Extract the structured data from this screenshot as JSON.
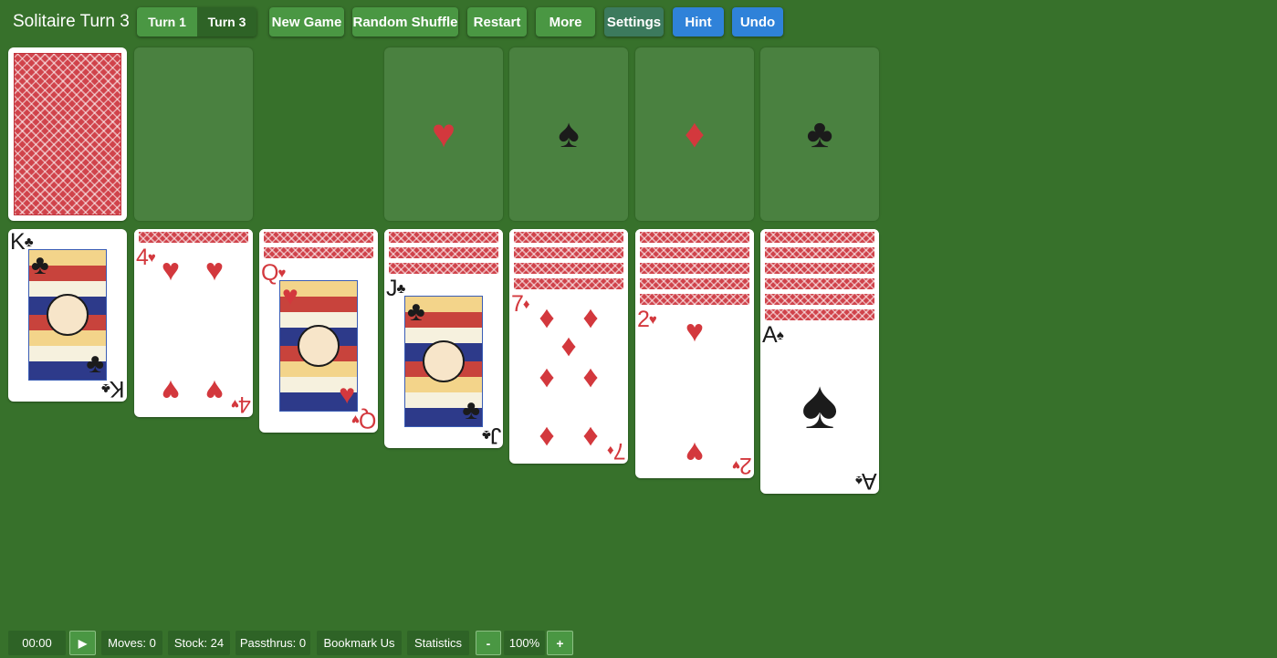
{
  "app": {
    "title": "Solitaire Turn 3"
  },
  "toolbar": {
    "turn1": "Turn 1",
    "turn3": "Turn 3",
    "new_game": "New Game",
    "random_shuffle": "Random Shuffle",
    "restart": "Restart",
    "more": "More",
    "settings": "Settings",
    "hint": "Hint",
    "undo": "Undo"
  },
  "foundations": [
    {
      "suit": "♥",
      "color": "red"
    },
    {
      "suit": "♠",
      "color": "black"
    },
    {
      "suit": "♦",
      "color": "red"
    },
    {
      "suit": "♣",
      "color": "black"
    }
  ],
  "tableau": [
    {
      "face_down": 0,
      "rank": "K",
      "suit": "♣",
      "color": "black"
    },
    {
      "face_down": 1,
      "rank": "4",
      "suit": "♥",
      "color": "red"
    },
    {
      "face_down": 2,
      "rank": "Q",
      "suit": "♥",
      "color": "red"
    },
    {
      "face_down": 3,
      "rank": "J",
      "suit": "♣",
      "color": "black"
    },
    {
      "face_down": 4,
      "rank": "7",
      "suit": "♦",
      "color": "red"
    },
    {
      "face_down": 5,
      "rank": "2",
      "suit": "♥",
      "color": "red"
    },
    {
      "face_down": 6,
      "rank": "A",
      "suit": "♠",
      "color": "black"
    }
  ],
  "status": {
    "timer": "00:00",
    "play_icon": "▶",
    "moves": "Moves: 0",
    "stock": "Stock: 24",
    "passthrus": "Passthrus: 0",
    "bookmark": "Bookmark Us",
    "statistics": "Statistics",
    "zoom_out": "-",
    "zoom": "100%",
    "zoom_in": "+"
  },
  "colors": {
    "table": "#37712b",
    "slot": "#4a8140",
    "button_green": "#4a9743",
    "button_blue": "#2f82d9",
    "card_red": "#d3383d",
    "card_back": "#d0434b"
  }
}
